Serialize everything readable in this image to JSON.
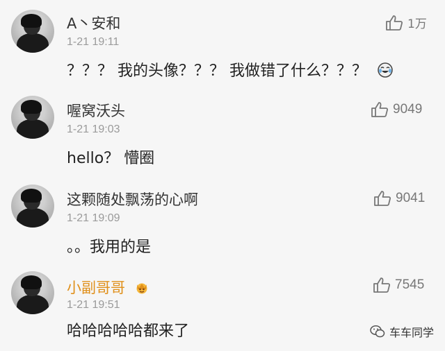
{
  "comments": [
    {
      "username": "A丶安和",
      "time": "1-21 19:11",
      "text": "？？？ 我的头像？？？ 我做错了什么？？？",
      "likes": "1万",
      "has_emoji": true,
      "username_color": "#333333"
    },
    {
      "username": "喔窝沃头",
      "time": "1-21 19:03",
      "text": "hello？ 懵圈",
      "likes": "9049",
      "username_color": "#333333"
    },
    {
      "username": "这颗随处飘荡的心啊",
      "time": "1-21 19:09",
      "text": "。。我用的是",
      "likes": "9041",
      "username_color": "#333333"
    },
    {
      "username": "小副哥哥",
      "time": "1-21 19:51",
      "text": "哈哈哈哈哈都来了",
      "likes": "7545",
      "has_badge": true,
      "username_color": "#e0901b"
    }
  ],
  "watermark": {
    "text": "车车同学",
    "icon": "wechat-icon"
  },
  "icons": {
    "like": "thumbs-up-icon",
    "emoji": "crying-laughing-emoji-icon",
    "badge": "vip-crown-icon"
  },
  "colors": {
    "background": "#f6f6f6",
    "vip_name": "#e0901b",
    "muted": "#9a9a9a",
    "text": "#222222"
  }
}
